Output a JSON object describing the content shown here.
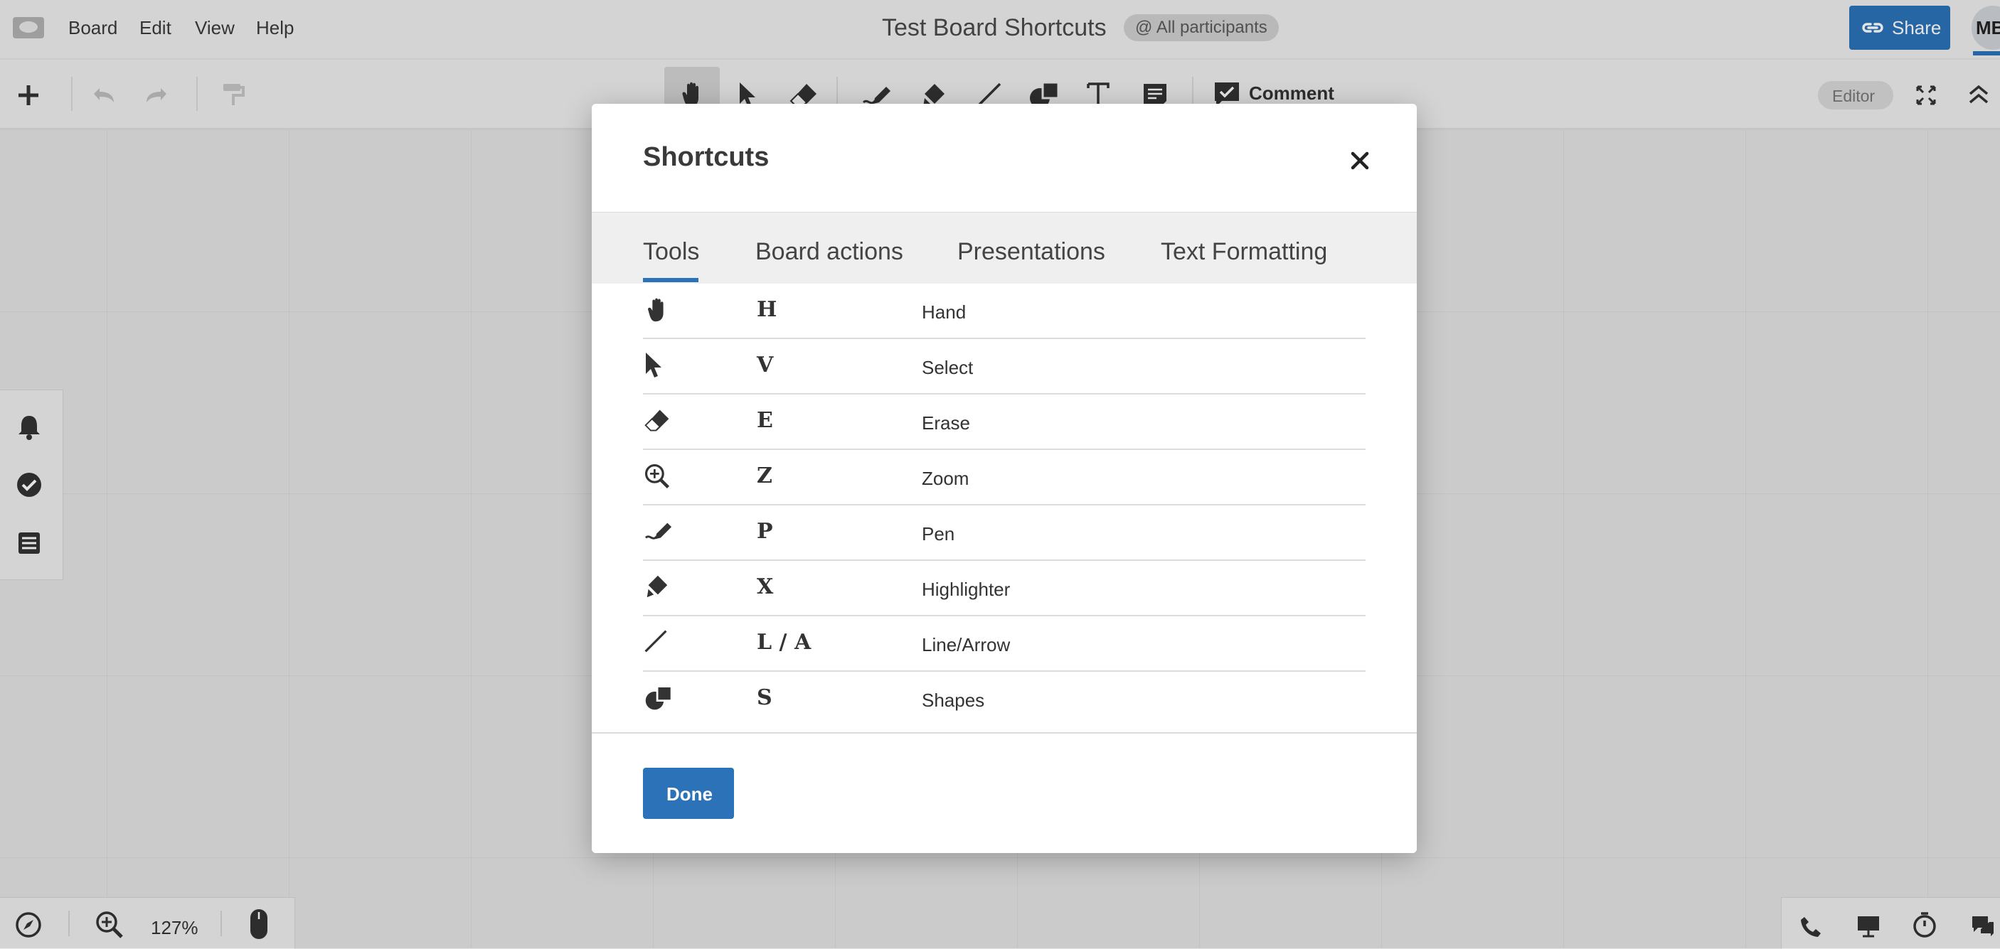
{
  "menubar": {
    "items": [
      "Board",
      "Edit",
      "View",
      "Help"
    ],
    "board_title": "Test Board Shortcuts",
    "participants": "@ All participants",
    "share_label": "Share",
    "avatar_initials": "MB"
  },
  "toolbar": {
    "comment_label": "Comment",
    "mode_label": "Editor"
  },
  "bottom_bar": {
    "zoom_level": "127%"
  },
  "modal": {
    "title": "Shortcuts",
    "tabs": [
      "Tools",
      "Board actions",
      "Presentations",
      "Text Formatting"
    ],
    "active_tab": "Tools",
    "rows": [
      {
        "icon": "hand-icon",
        "key": "H",
        "name": "Hand"
      },
      {
        "icon": "select-cursor-icon",
        "key": "V",
        "name": "Select"
      },
      {
        "icon": "eraser-icon",
        "key": "E",
        "name": "Erase"
      },
      {
        "icon": "zoom-icon",
        "key": "Z",
        "name": "Zoom"
      },
      {
        "icon": "pen-icon",
        "key": "P",
        "name": "Pen"
      },
      {
        "icon": "highlighter-icon",
        "key": "X",
        "name": "Highlighter"
      },
      {
        "icon": "line-icon",
        "key": "L / A",
        "name": "Line/Arrow"
      },
      {
        "icon": "shapes-icon",
        "key": "S",
        "name": "Shapes"
      }
    ],
    "done_label": "Done"
  },
  "colors": {
    "accent": "#2b72b8",
    "background": "#e3e3e3",
    "modal": "#ffffff"
  }
}
